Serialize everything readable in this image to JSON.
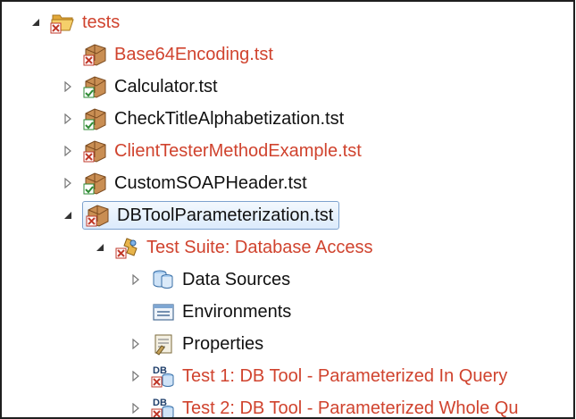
{
  "tree": {
    "root": {
      "label": "tests",
      "state": "error",
      "expanded": true,
      "icon": "folder-open-icon"
    },
    "files": [
      {
        "label": "Base64Encoding.tst",
        "state": "error",
        "expander": "none"
      },
      {
        "label": "Calculator.tst",
        "state": "ok",
        "expander": "collapsed"
      },
      {
        "label": "CheckTitleAlphabetization.tst",
        "state": "ok",
        "expander": "collapsed"
      },
      {
        "label": "ClientTesterMethodExample.tst",
        "state": "error",
        "expander": "collapsed"
      },
      {
        "label": "CustomSOAPHeader.tst",
        "state": "ok",
        "expander": "collapsed"
      },
      {
        "label": "DBToolParameterization.tst",
        "state": "error",
        "expander": "expanded",
        "selected": true
      }
    ],
    "suite": {
      "label": "Test Suite: Database Access",
      "state": "error",
      "expander": "expanded"
    },
    "suite_children": [
      {
        "label": "Data Sources",
        "state": "ok",
        "expander": "collapsed",
        "icon": "data-sources-icon"
      },
      {
        "label": "Environments",
        "state": "ok",
        "expander": "none",
        "icon": "environments-icon"
      },
      {
        "label": "Properties",
        "state": "ok",
        "expander": "collapsed",
        "icon": "properties-icon"
      },
      {
        "label": "Test 1: DB Tool - Parameterized In Query",
        "state": "error",
        "expander": "collapsed",
        "icon": "db-tool-icon"
      },
      {
        "label": "Test 2: DB Tool - Parameterized Whole Qu",
        "state": "error",
        "expander": "collapsed",
        "icon": "db-tool-icon"
      }
    ]
  },
  "colors": {
    "error_text": "#d0432e",
    "ok_text": "#111111",
    "selection_border": "#7da2ce",
    "selection_fill": "#dcebfc"
  }
}
